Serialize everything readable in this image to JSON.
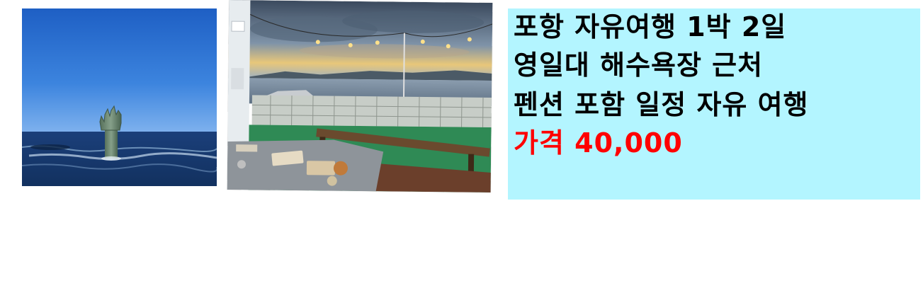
{
  "listing": {
    "title_line1": "포항 자유여행 1박 2일",
    "title_line2": "영일대 해수욕장 근처",
    "title_line3": "펜션 포함 일정 자유 여행",
    "price_label": "가격",
    "price_value": "40,000"
  },
  "colors": {
    "panel_background": "#b3f5ff",
    "price_color": "#ff0000",
    "text_color": "#000000"
  }
}
